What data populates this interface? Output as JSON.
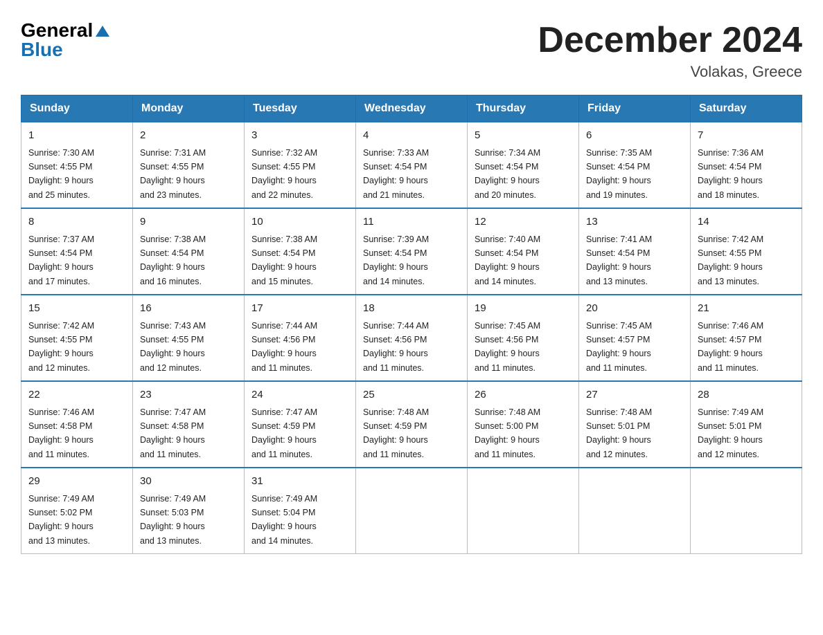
{
  "header": {
    "logo_general": "General",
    "logo_blue": "Blue",
    "month_title": "December 2024",
    "location": "Volakas, Greece"
  },
  "days_of_week": [
    "Sunday",
    "Monday",
    "Tuesday",
    "Wednesday",
    "Thursday",
    "Friday",
    "Saturday"
  ],
  "weeks": [
    [
      {
        "day": "1",
        "sunrise": "7:30 AM",
        "sunset": "4:55 PM",
        "daylight": "9 hours and 25 minutes."
      },
      {
        "day": "2",
        "sunrise": "7:31 AM",
        "sunset": "4:55 PM",
        "daylight": "9 hours and 23 minutes."
      },
      {
        "day": "3",
        "sunrise": "7:32 AM",
        "sunset": "4:55 PM",
        "daylight": "9 hours and 22 minutes."
      },
      {
        "day": "4",
        "sunrise": "7:33 AM",
        "sunset": "4:54 PM",
        "daylight": "9 hours and 21 minutes."
      },
      {
        "day": "5",
        "sunrise": "7:34 AM",
        "sunset": "4:54 PM",
        "daylight": "9 hours and 20 minutes."
      },
      {
        "day": "6",
        "sunrise": "7:35 AM",
        "sunset": "4:54 PM",
        "daylight": "9 hours and 19 minutes."
      },
      {
        "day": "7",
        "sunrise": "7:36 AM",
        "sunset": "4:54 PM",
        "daylight": "9 hours and 18 minutes."
      }
    ],
    [
      {
        "day": "8",
        "sunrise": "7:37 AM",
        "sunset": "4:54 PM",
        "daylight": "9 hours and 17 minutes."
      },
      {
        "day": "9",
        "sunrise": "7:38 AM",
        "sunset": "4:54 PM",
        "daylight": "9 hours and 16 minutes."
      },
      {
        "day": "10",
        "sunrise": "7:38 AM",
        "sunset": "4:54 PM",
        "daylight": "9 hours and 15 minutes."
      },
      {
        "day": "11",
        "sunrise": "7:39 AM",
        "sunset": "4:54 PM",
        "daylight": "9 hours and 14 minutes."
      },
      {
        "day": "12",
        "sunrise": "7:40 AM",
        "sunset": "4:54 PM",
        "daylight": "9 hours and 14 minutes."
      },
      {
        "day": "13",
        "sunrise": "7:41 AM",
        "sunset": "4:54 PM",
        "daylight": "9 hours and 13 minutes."
      },
      {
        "day": "14",
        "sunrise": "7:42 AM",
        "sunset": "4:55 PM",
        "daylight": "9 hours and 13 minutes."
      }
    ],
    [
      {
        "day": "15",
        "sunrise": "7:42 AM",
        "sunset": "4:55 PM",
        "daylight": "9 hours and 12 minutes."
      },
      {
        "day": "16",
        "sunrise": "7:43 AM",
        "sunset": "4:55 PM",
        "daylight": "9 hours and 12 minutes."
      },
      {
        "day": "17",
        "sunrise": "7:44 AM",
        "sunset": "4:56 PM",
        "daylight": "9 hours and 11 minutes."
      },
      {
        "day": "18",
        "sunrise": "7:44 AM",
        "sunset": "4:56 PM",
        "daylight": "9 hours and 11 minutes."
      },
      {
        "day": "19",
        "sunrise": "7:45 AM",
        "sunset": "4:56 PM",
        "daylight": "9 hours and 11 minutes."
      },
      {
        "day": "20",
        "sunrise": "7:45 AM",
        "sunset": "4:57 PM",
        "daylight": "9 hours and 11 minutes."
      },
      {
        "day": "21",
        "sunrise": "7:46 AM",
        "sunset": "4:57 PM",
        "daylight": "9 hours and 11 minutes."
      }
    ],
    [
      {
        "day": "22",
        "sunrise": "7:46 AM",
        "sunset": "4:58 PM",
        "daylight": "9 hours and 11 minutes."
      },
      {
        "day": "23",
        "sunrise": "7:47 AM",
        "sunset": "4:58 PM",
        "daylight": "9 hours and 11 minutes."
      },
      {
        "day": "24",
        "sunrise": "7:47 AM",
        "sunset": "4:59 PM",
        "daylight": "9 hours and 11 minutes."
      },
      {
        "day": "25",
        "sunrise": "7:48 AM",
        "sunset": "4:59 PM",
        "daylight": "9 hours and 11 minutes."
      },
      {
        "day": "26",
        "sunrise": "7:48 AM",
        "sunset": "5:00 PM",
        "daylight": "9 hours and 11 minutes."
      },
      {
        "day": "27",
        "sunrise": "7:48 AM",
        "sunset": "5:01 PM",
        "daylight": "9 hours and 12 minutes."
      },
      {
        "day": "28",
        "sunrise": "7:49 AM",
        "sunset": "5:01 PM",
        "daylight": "9 hours and 12 minutes."
      }
    ],
    [
      {
        "day": "29",
        "sunrise": "7:49 AM",
        "sunset": "5:02 PM",
        "daylight": "9 hours and 13 minutes."
      },
      {
        "day": "30",
        "sunrise": "7:49 AM",
        "sunset": "5:03 PM",
        "daylight": "9 hours and 13 minutes."
      },
      {
        "day": "31",
        "sunrise": "7:49 AM",
        "sunset": "5:04 PM",
        "daylight": "9 hours and 14 minutes."
      },
      null,
      null,
      null,
      null
    ]
  ],
  "labels": {
    "sunrise": "Sunrise:",
    "sunset": "Sunset:",
    "daylight": "Daylight:"
  }
}
